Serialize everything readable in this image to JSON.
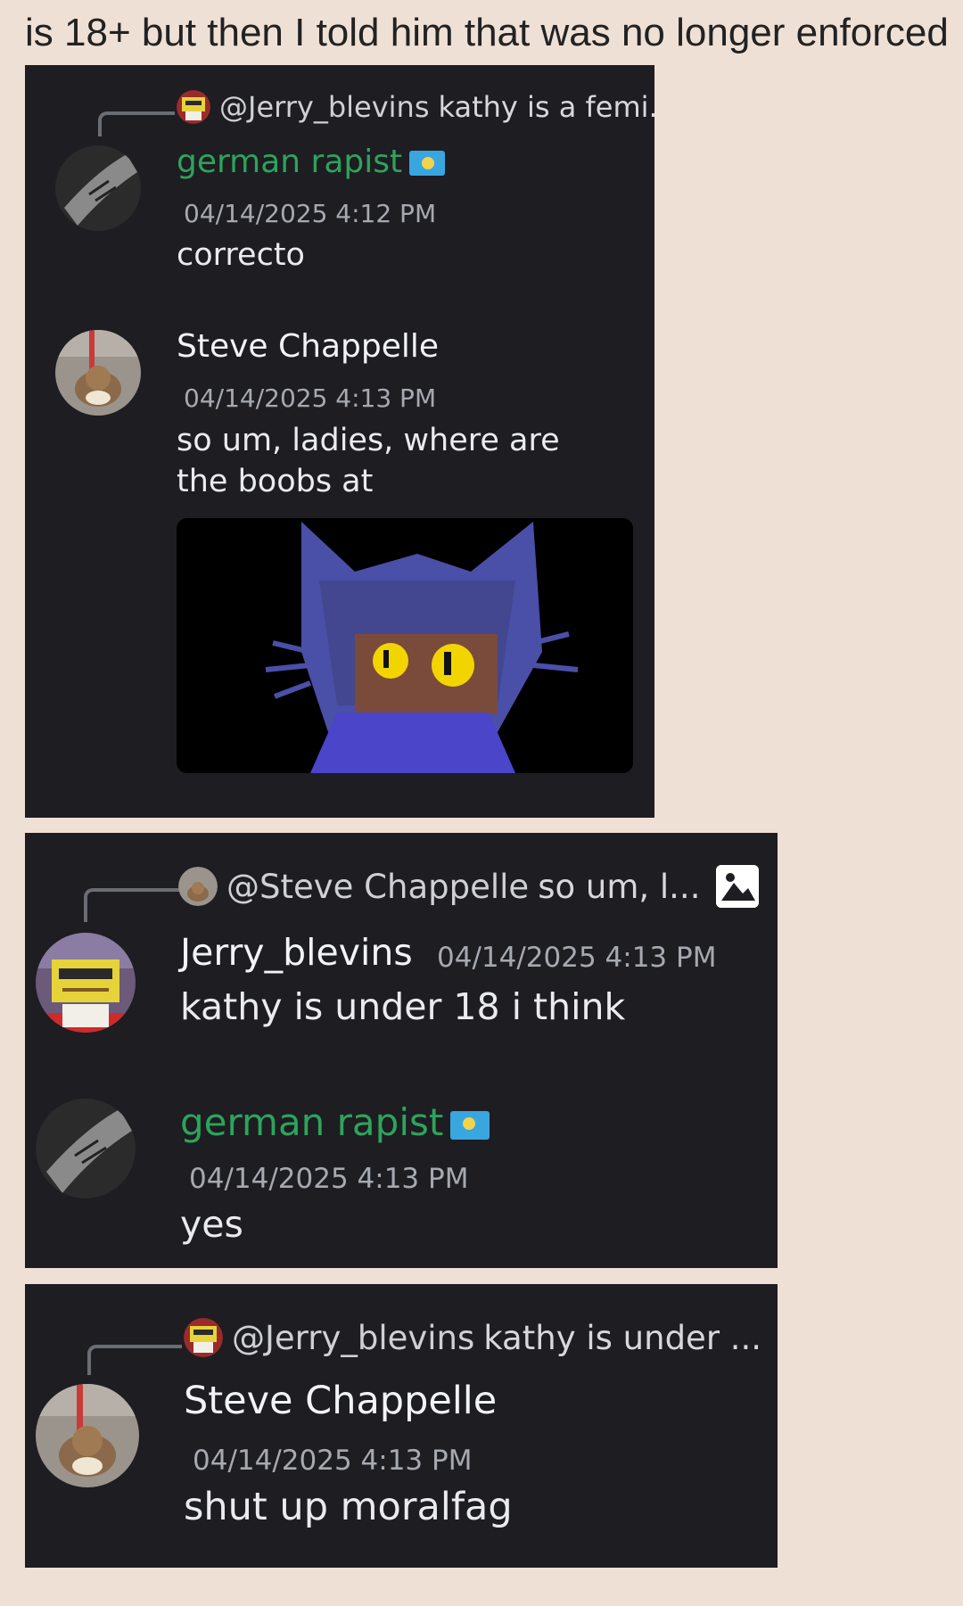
{
  "caption": "is 18+ but then I told him that was no longer enforced",
  "cards": [
    {
      "reply_handle": "@Jerry_blevins",
      "reply_text": "kathy is a femi...",
      "messages": [
        {
          "author": "german rapist",
          "timestamp": "04/14/2025 4:12 PM",
          "text": "correcto",
          "author_color": "#2ea35c"
        },
        {
          "author": "Steve Chappelle",
          "timestamp": "04/14/2025 4:13 PM",
          "text": "so um, ladies, where are the boobs at",
          "author_color": "#f2f3f5"
        }
      ]
    },
    {
      "reply_handle": "@Steve Chappelle",
      "reply_text": "so um, l...",
      "messages": [
        {
          "author": "Jerry_blevins",
          "timestamp": "04/14/2025 4:13 PM",
          "text": "kathy is under 18 i think",
          "author_color": "#f2f3f5"
        },
        {
          "author": "german rapist",
          "timestamp": "04/14/2025 4:13 PM",
          "text": "yes",
          "author_color": "#2ea35c"
        }
      ]
    },
    {
      "reply_handle": "@Jerry_blevins",
      "reply_text": "kathy is under ...",
      "messages": [
        {
          "author": "Steve Chappelle",
          "timestamp": "04/14/2025 4:13 PM",
          "text": "shut up moralfag",
          "author_color": "#f2f3f5"
        }
      ]
    }
  ],
  "icons": {
    "flag": "kazakhstan-flag-icon",
    "image_attachment": "image-icon"
  },
  "colors": {
    "page_bg": "#efe0d6",
    "card_bg": "#1d1d22",
    "green_name": "#2ea35c",
    "timestamp": "#a7a9b1"
  }
}
